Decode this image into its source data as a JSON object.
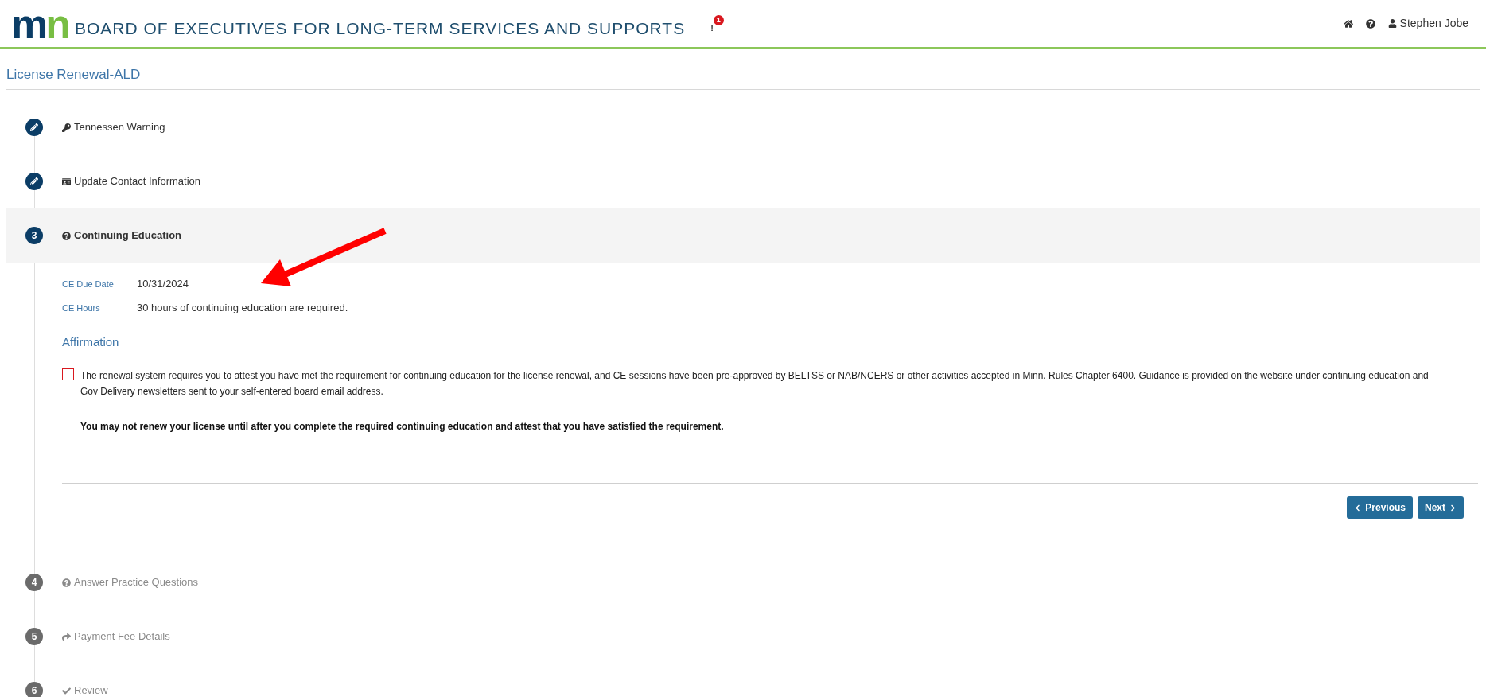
{
  "header": {
    "logo_text": "mn",
    "title": "BOARD OF EXECUTIVES FOR LONG-TERM SERVICES AND SUPPORTS",
    "alert_mark": "!",
    "alert_count": "1",
    "user_name": "Stephen Jobe"
  },
  "page_title": "License Renewal-ALD",
  "steps": [
    {
      "completed": true,
      "selected": false,
      "label": "Tennessen Warning"
    },
    {
      "completed": true,
      "selected": false,
      "label": "Update Contact Information"
    },
    {
      "completed": false,
      "selected": true,
      "number": "3",
      "label": "Continuing Education"
    },
    {
      "completed": false,
      "selected": false,
      "number": "4",
      "label": "Answer Practice Questions"
    },
    {
      "completed": false,
      "selected": false,
      "number": "5",
      "label": "Payment Fee Details"
    },
    {
      "completed": false,
      "selected": false,
      "number": "6",
      "label": "Review"
    }
  ],
  "details": [
    {
      "label": "CE Due Date",
      "value": "10/31/2024"
    },
    {
      "label": "CE Hours",
      "value": "30 hours of continuing education are required."
    }
  ],
  "affirmation": {
    "heading": "Affirmation",
    "checked": false,
    "text": "The renewal system requires you to attest you have met the requirement for continuing education for the license renewal, and CE sessions have been pre-approved by BELTSS or NAB/NCERS or other activities accepted in Minn. Rules Chapter 6400.  Guidance is provided on the website under continuing education and Gov Delivery newsletters sent to your self-entered board email address.",
    "warning": "You may not renew your license until after you complete the required continuing education and attest that you have satisfied the requirement."
  },
  "buttons": [
    {
      "kind": "previous",
      "label": "Previous"
    },
    {
      "kind": "next",
      "label": "Next"
    }
  ]
}
